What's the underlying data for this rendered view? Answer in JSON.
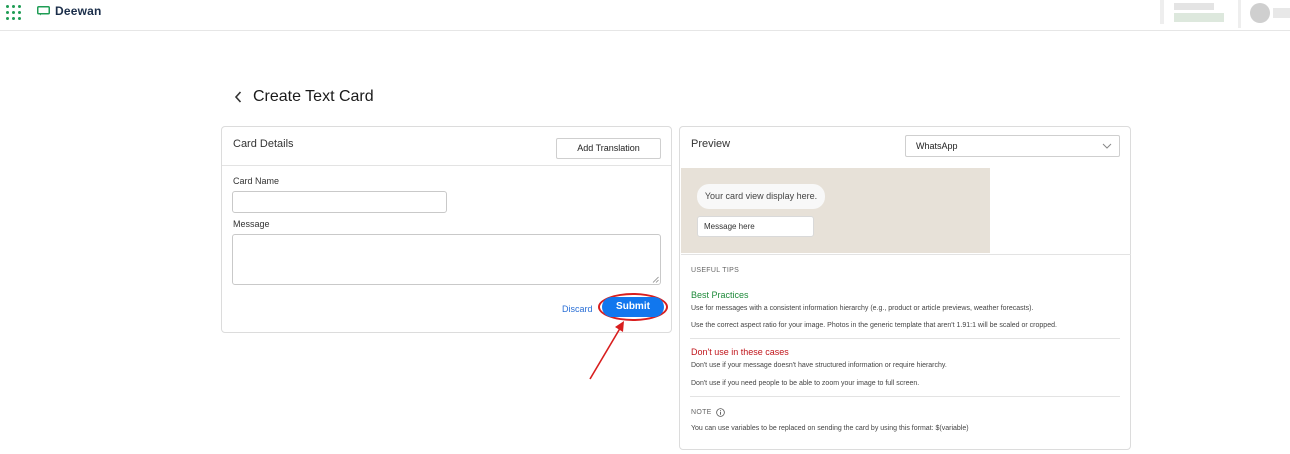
{
  "header": {
    "brand": "Deewan",
    "brand_color": "#1f9d55"
  },
  "page": {
    "title": "Create Text Card"
  },
  "details": {
    "title": "Card Details",
    "add_translation_label": "Add Translation",
    "card_name_label": "Card Name",
    "card_name_value": "",
    "message_label": "Message",
    "message_value": "",
    "discard_label": "Discard",
    "submit_label": "Submit"
  },
  "preview": {
    "title": "Preview",
    "platform_value": "WhatsApp",
    "bubble_text": "Your card view display here.",
    "message_placeholder": "Message here",
    "tips_heading": "USEFUL TIPS",
    "best_title": "Best Practices",
    "best_lines": [
      "Use for messages with a consistent information hierarchy (e.g., product or article previews, weather forecasts).",
      "Use the correct aspect ratio for your image. Photos in the generic template that aren't 1.91:1 will be scaled or cropped."
    ],
    "dont_title": "Don't use in these cases",
    "dont_lines": [
      "Don't use if your message doesn't have structured information or require hierarchy.",
      "Don't use if you need people to be able to zoom your image to full screen."
    ],
    "note_heading": "NOTE",
    "note_text": "You can use variables to be replaced on sending the card by using this format: $(variable)"
  },
  "colors": {
    "accent": "#1177ee",
    "annotation": "#d81e1e",
    "good": "#1e8a3a",
    "bad": "#c0151b"
  }
}
